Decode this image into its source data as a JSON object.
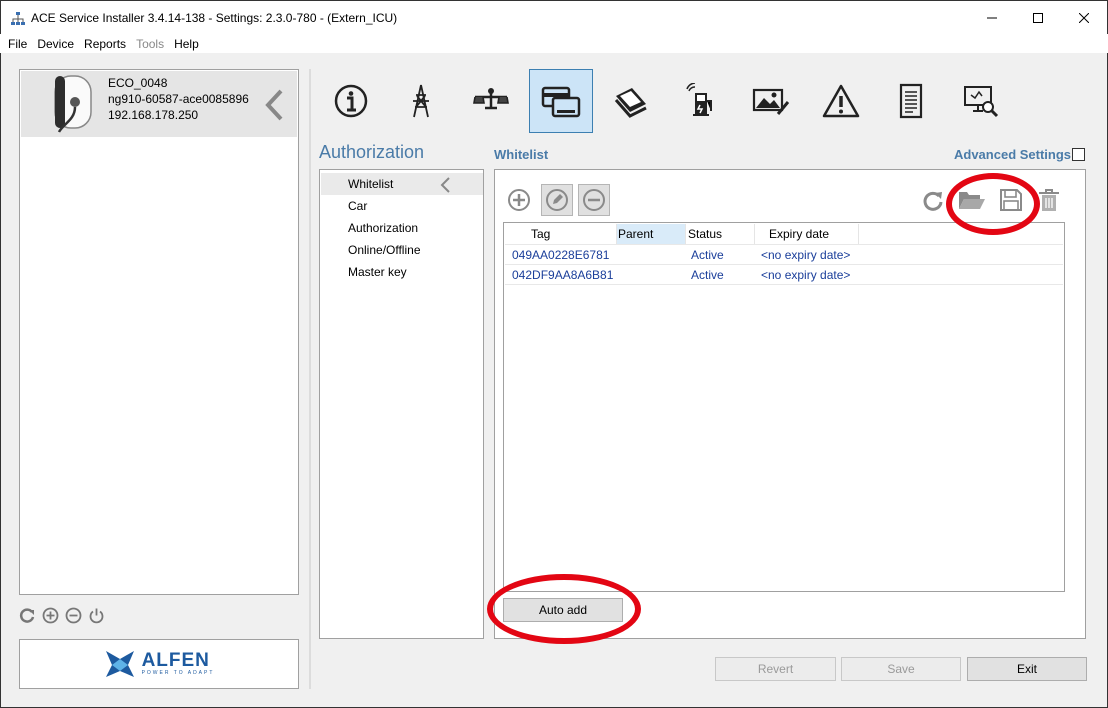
{
  "window": {
    "title": "ACE Service Installer 3.4.14-138 - Settings: 2.3.0-780 -  (Extern_ICU)"
  },
  "menu": {
    "items": [
      {
        "label": "File",
        "enabled": true
      },
      {
        "label": "Device",
        "enabled": true
      },
      {
        "label": "Reports",
        "enabled": true
      },
      {
        "label": "Tools",
        "enabled": false
      },
      {
        "label": "Help",
        "enabled": true
      }
    ]
  },
  "device": {
    "name": "ECO_0048",
    "id": "ng910-60587-ace0085896",
    "ip": "192.168.178.250"
  },
  "brand": {
    "name": "ALFEN",
    "tagline": "POWER TO ADAPT",
    "color": "#1d5a9f"
  },
  "toolbar": {
    "icons": [
      "info-icon",
      "power-tower-icon",
      "balance-icon",
      "card-reader-icon",
      "payment-terminal-icon",
      "charging-station-icon",
      "image-edit-icon",
      "warning-icon",
      "document-icon",
      "monitor-search-icon"
    ],
    "active": "card-reader-icon"
  },
  "section": {
    "title": "Authorization"
  },
  "nav": {
    "items": [
      {
        "label": "Whitelist",
        "selected": true
      },
      {
        "label": "Car",
        "selected": false
      },
      {
        "label": "Authorization",
        "selected": false
      },
      {
        "label": "Online/Offline",
        "selected": false
      },
      {
        "label": "Master key",
        "selected": false
      }
    ]
  },
  "whitelist": {
    "title": "Whitelist",
    "advanced_settings_label": "Advanced Settings",
    "advanced_settings_checked": false,
    "columns": [
      "Tag",
      "Parent",
      "Status",
      "Expiry date"
    ],
    "rows": [
      {
        "tag": "049AA0228E6781",
        "parent": "",
        "status": "Active",
        "expiry": "<no expiry date>"
      },
      {
        "tag": "042DF9AA8A6B81",
        "parent": "",
        "status": "Active",
        "expiry": "<no expiry date>"
      }
    ],
    "auto_add_label": "Auto add"
  },
  "footer": {
    "revert_label": "Revert",
    "save_label": "Save",
    "exit_label": "Exit"
  },
  "colors": {
    "accent": "#4a7ba8",
    "highlight": "#e30613",
    "selected_tab": "#cce4f7"
  }
}
